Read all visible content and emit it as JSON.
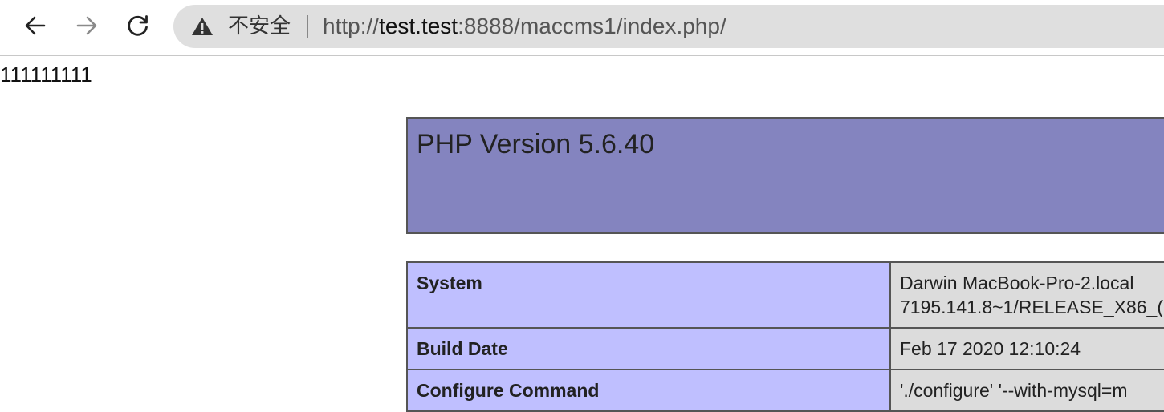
{
  "browser": {
    "security_label": "不安全",
    "url_prefix": "http://",
    "url_host": "test.test",
    "url_rest": ":8888/maccms1/index.php/",
    "icons": [
      "back-arrow-icon",
      "forward-arrow-icon",
      "reload-icon",
      "warning-icon"
    ]
  },
  "page": {
    "output_text": "111111111"
  },
  "phpinfo": {
    "title": "PHP Version 5.6.40",
    "header_color": "#8484bf",
    "label_color": "#bfbfff",
    "value_color": "#dcdcdc",
    "rows": [
      {
        "label": "System",
        "value_line1": "Darwin MacBook-Pro-2.local",
        "value_line2": "7195.141.8~1/RELEASE_X86_("
      },
      {
        "label": "Build Date",
        "value_line1": "Feb 17 2020 12:10:24"
      },
      {
        "label": "Configure Command",
        "value_line1": "'./configure' '--with-mysql=m"
      }
    ]
  }
}
